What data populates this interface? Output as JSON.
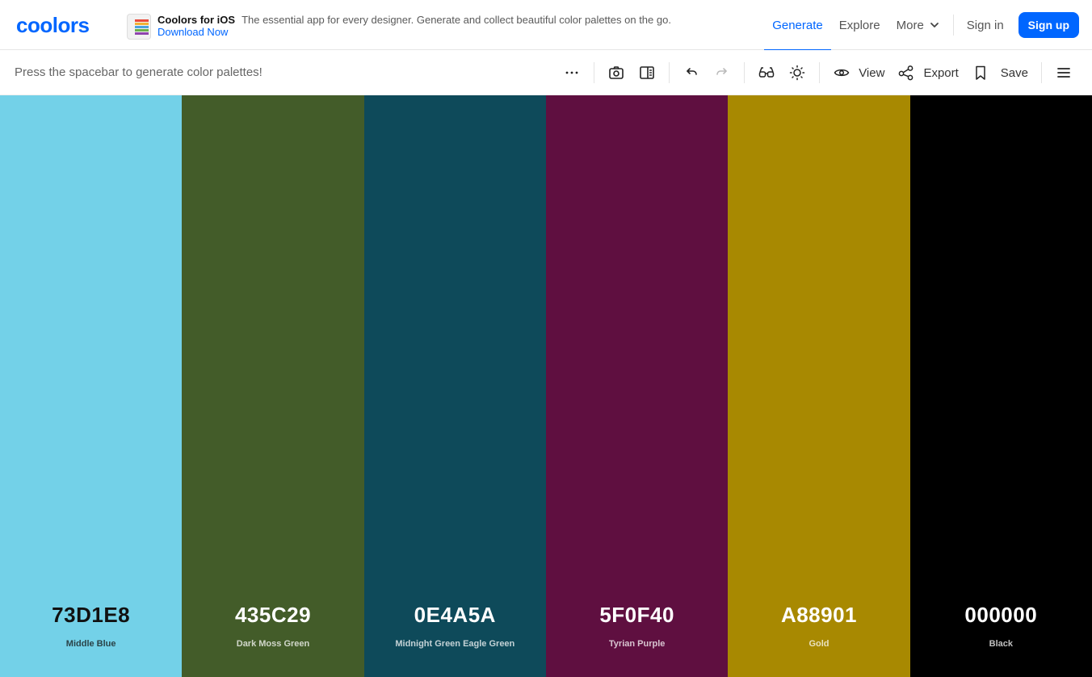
{
  "brand": {
    "logo_text": "coolors",
    "color": "#0066ff"
  },
  "promo": {
    "title": "Coolors for iOS",
    "description": "The essential app for every designer. Generate and collect beautiful color palettes on the go.",
    "link": "Download Now"
  },
  "nav": {
    "items": [
      {
        "label": "Generate",
        "active": true
      },
      {
        "label": "Explore"
      },
      {
        "label": "More"
      }
    ],
    "sign_in": "Sign in",
    "sign_up": "Sign up"
  },
  "toolbar": {
    "hint": "Press the spacebar to generate color palettes!",
    "view_label": "View",
    "export_label": "Export",
    "save_label": "Save",
    "icons": [
      "more-options-icon",
      "camera-icon",
      "sidebar-panel-icon",
      "undo-icon",
      "redo-icon",
      "glasses-icon",
      "sun-icon",
      "eye-icon",
      "share-icon",
      "bookmark-icon",
      "menu-icon"
    ]
  },
  "palette": [
    {
      "hex": "73D1E8",
      "name": "Middle Blue",
      "color": "#73D1E8",
      "text_color": "#111111"
    },
    {
      "hex": "435C29",
      "name": "Dark Moss Green",
      "color": "#435C29",
      "text_color": "#ffffff"
    },
    {
      "hex": "0E4A5A",
      "name": "Midnight Green Eagle Green",
      "color": "#0E4A5A",
      "text_color": "#ffffff"
    },
    {
      "hex": "5F0F40",
      "name": "Tyrian Purple",
      "color": "#5F0F40",
      "text_color": "#ffffff"
    },
    {
      "hex": "A88901",
      "name": "Gold",
      "color": "#A88901",
      "text_color": "#ffffff"
    },
    {
      "hex": "000000",
      "name": "Black",
      "color": "#000000",
      "text_color": "#ffffff"
    }
  ]
}
